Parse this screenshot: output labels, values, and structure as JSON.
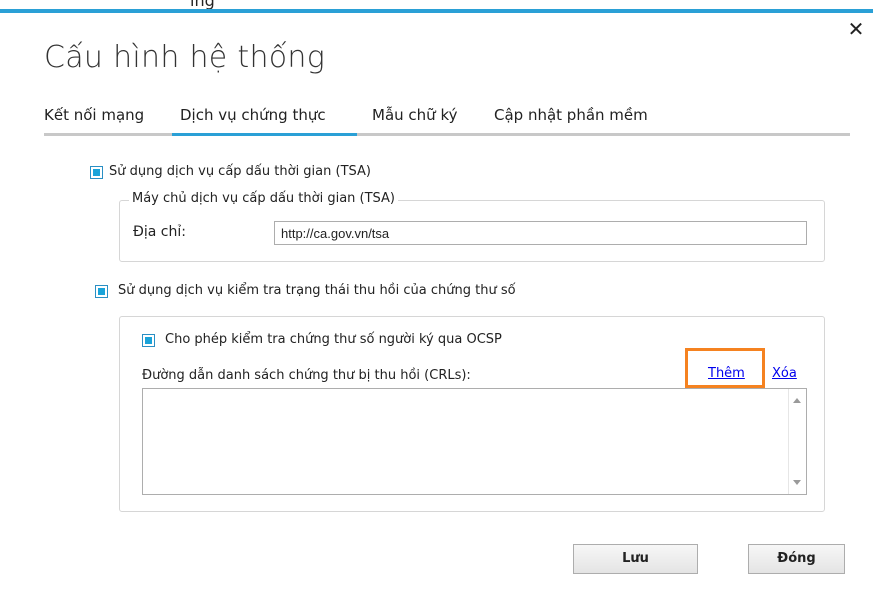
{
  "window": {
    "partial_title": "ing",
    "title": "Cấu hình hệ thống",
    "close_glyph": "✕"
  },
  "tabs": [
    {
      "label": "Kết nối mạng",
      "active": false
    },
    {
      "label": "Dịch vụ chứng thực",
      "active": true
    },
    {
      "label": "Mẫu chữ ký",
      "active": false
    },
    {
      "label": "Cập nhật phần mềm",
      "active": false
    }
  ],
  "tsa": {
    "checkbox_label": "Sử dụng dịch vụ cấp dấu thời gian (TSA)",
    "checked": true,
    "group_legend": "Máy chủ dịch vụ cấp dấu thời gian (TSA)",
    "address_label": "Địa chỉ:",
    "address_value": "http://ca.gov.vn/tsa"
  },
  "revocation": {
    "checkbox_label": "Sử dụng dịch vụ kiểm tra trạng thái thu hồi của chứng thư số",
    "checked": true,
    "ocsp_label": "Cho phép kiểm tra chứng thư số người ký qua OCSP",
    "ocsp_checked": true,
    "crl_label": "Đường dẫn danh sách chứng thư bị thu hồi (CRLs):",
    "add_link": "Thêm",
    "delete_link": "Xóa",
    "crl_items": []
  },
  "buttons": {
    "save": "Lưu",
    "close": "Đóng"
  },
  "colors": {
    "accent": "#2aa0d6",
    "highlight": "#f58220",
    "link": "#0000ee"
  }
}
